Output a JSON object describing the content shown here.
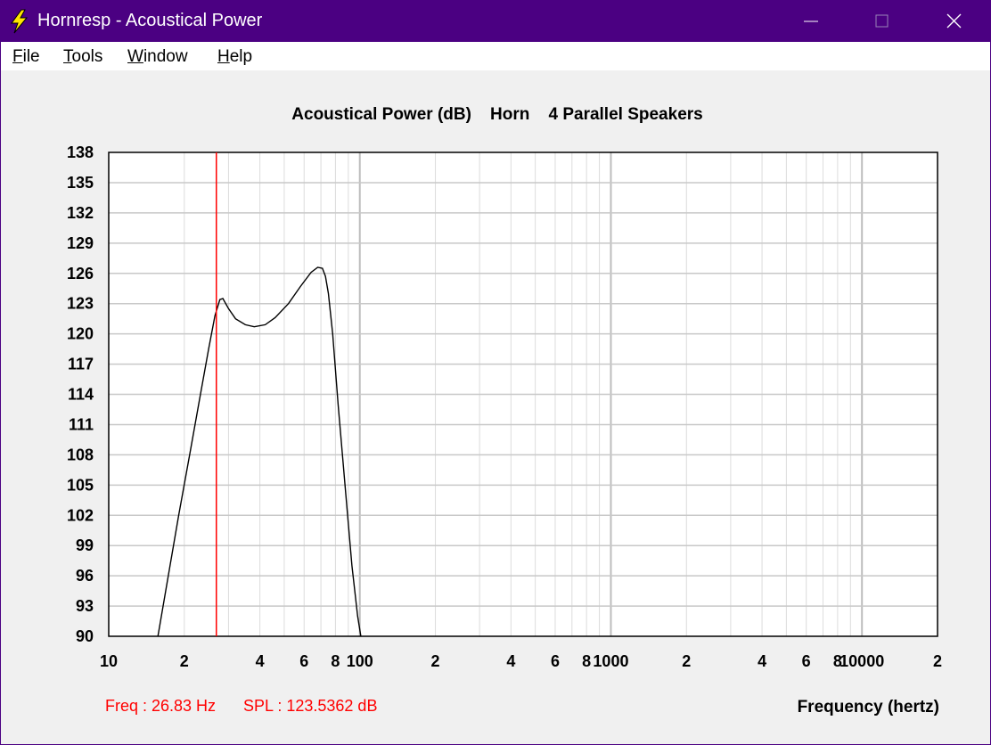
{
  "window": {
    "title": "Hornresp - Acoustical Power"
  },
  "menu": {
    "items": [
      "File",
      "Tools",
      "Window",
      "Help"
    ]
  },
  "colors": {
    "titlebar": "#4b0082",
    "trace": "#000000",
    "cursor": "#ff0000",
    "readout": "#ff0000",
    "grid": "#c8c8c8"
  },
  "icons": {
    "app": "lightning-icon",
    "minimize": "minimize-icon",
    "maximize": "maximize-icon",
    "close": "close-icon"
  },
  "chart_data": {
    "type": "line",
    "title": "Acoustical Power (dB)    Horn    4 Parallel Speakers",
    "xlabel": "Frequency (hertz)",
    "ylabel": "",
    "xscale": "log",
    "xlim": [
      10,
      20000
    ],
    "ylim": [
      90,
      138
    ],
    "grid": true,
    "yticks": [
      "138",
      "135",
      "132",
      "129",
      "126",
      "123",
      "120",
      "117",
      "114",
      "111",
      "108",
      "105",
      "102",
      "99",
      "96",
      "93",
      "90"
    ],
    "xticks": [
      {
        "v": 10,
        "t": "10"
      },
      {
        "v": 20,
        "t": "2"
      },
      {
        "v": 40,
        "t": "4"
      },
      {
        "v": 60,
        "t": "6"
      },
      {
        "v": 80,
        "t": "8"
      },
      {
        "v": 100,
        "t": "100"
      },
      {
        "v": 200,
        "t": "2"
      },
      {
        "v": 400,
        "t": "4"
      },
      {
        "v": 600,
        "t": "6"
      },
      {
        "v": 800,
        "t": "8"
      },
      {
        "v": 1000,
        "t": "1000"
      },
      {
        "v": 2000,
        "t": "2"
      },
      {
        "v": 4000,
        "t": "4"
      },
      {
        "v": 6000,
        "t": "6"
      },
      {
        "v": 8000,
        "t": "8"
      },
      {
        "v": 10000,
        "t": "10000"
      },
      {
        "v": 20000,
        "t": "2"
      }
    ],
    "series": [
      {
        "x": [
          15.7,
          17,
          19,
          21,
          23,
          25,
          26.5,
          27.7,
          28.5,
          30,
          32,
          35,
          38,
          42,
          46,
          52,
          58,
          64,
          68,
          71,
          73,
          75,
          78,
          82,
          88,
          93,
          98,
          101
        ],
        "y": [
          90,
          95,
          102,
          108,
          113.5,
          118.5,
          121.8,
          123.4,
          123.5,
          122.5,
          121.5,
          120.9,
          120.7,
          120.9,
          121.6,
          123,
          124.7,
          126.1,
          126.6,
          126.5,
          125.7,
          124,
          120,
          113,
          104,
          97,
          92,
          90
        ]
      }
    ],
    "cursor_x": 26.83,
    "readout": {
      "freq": "Freq : 26.83 Hz",
      "spl": "SPL : 123.5362 dB"
    }
  }
}
